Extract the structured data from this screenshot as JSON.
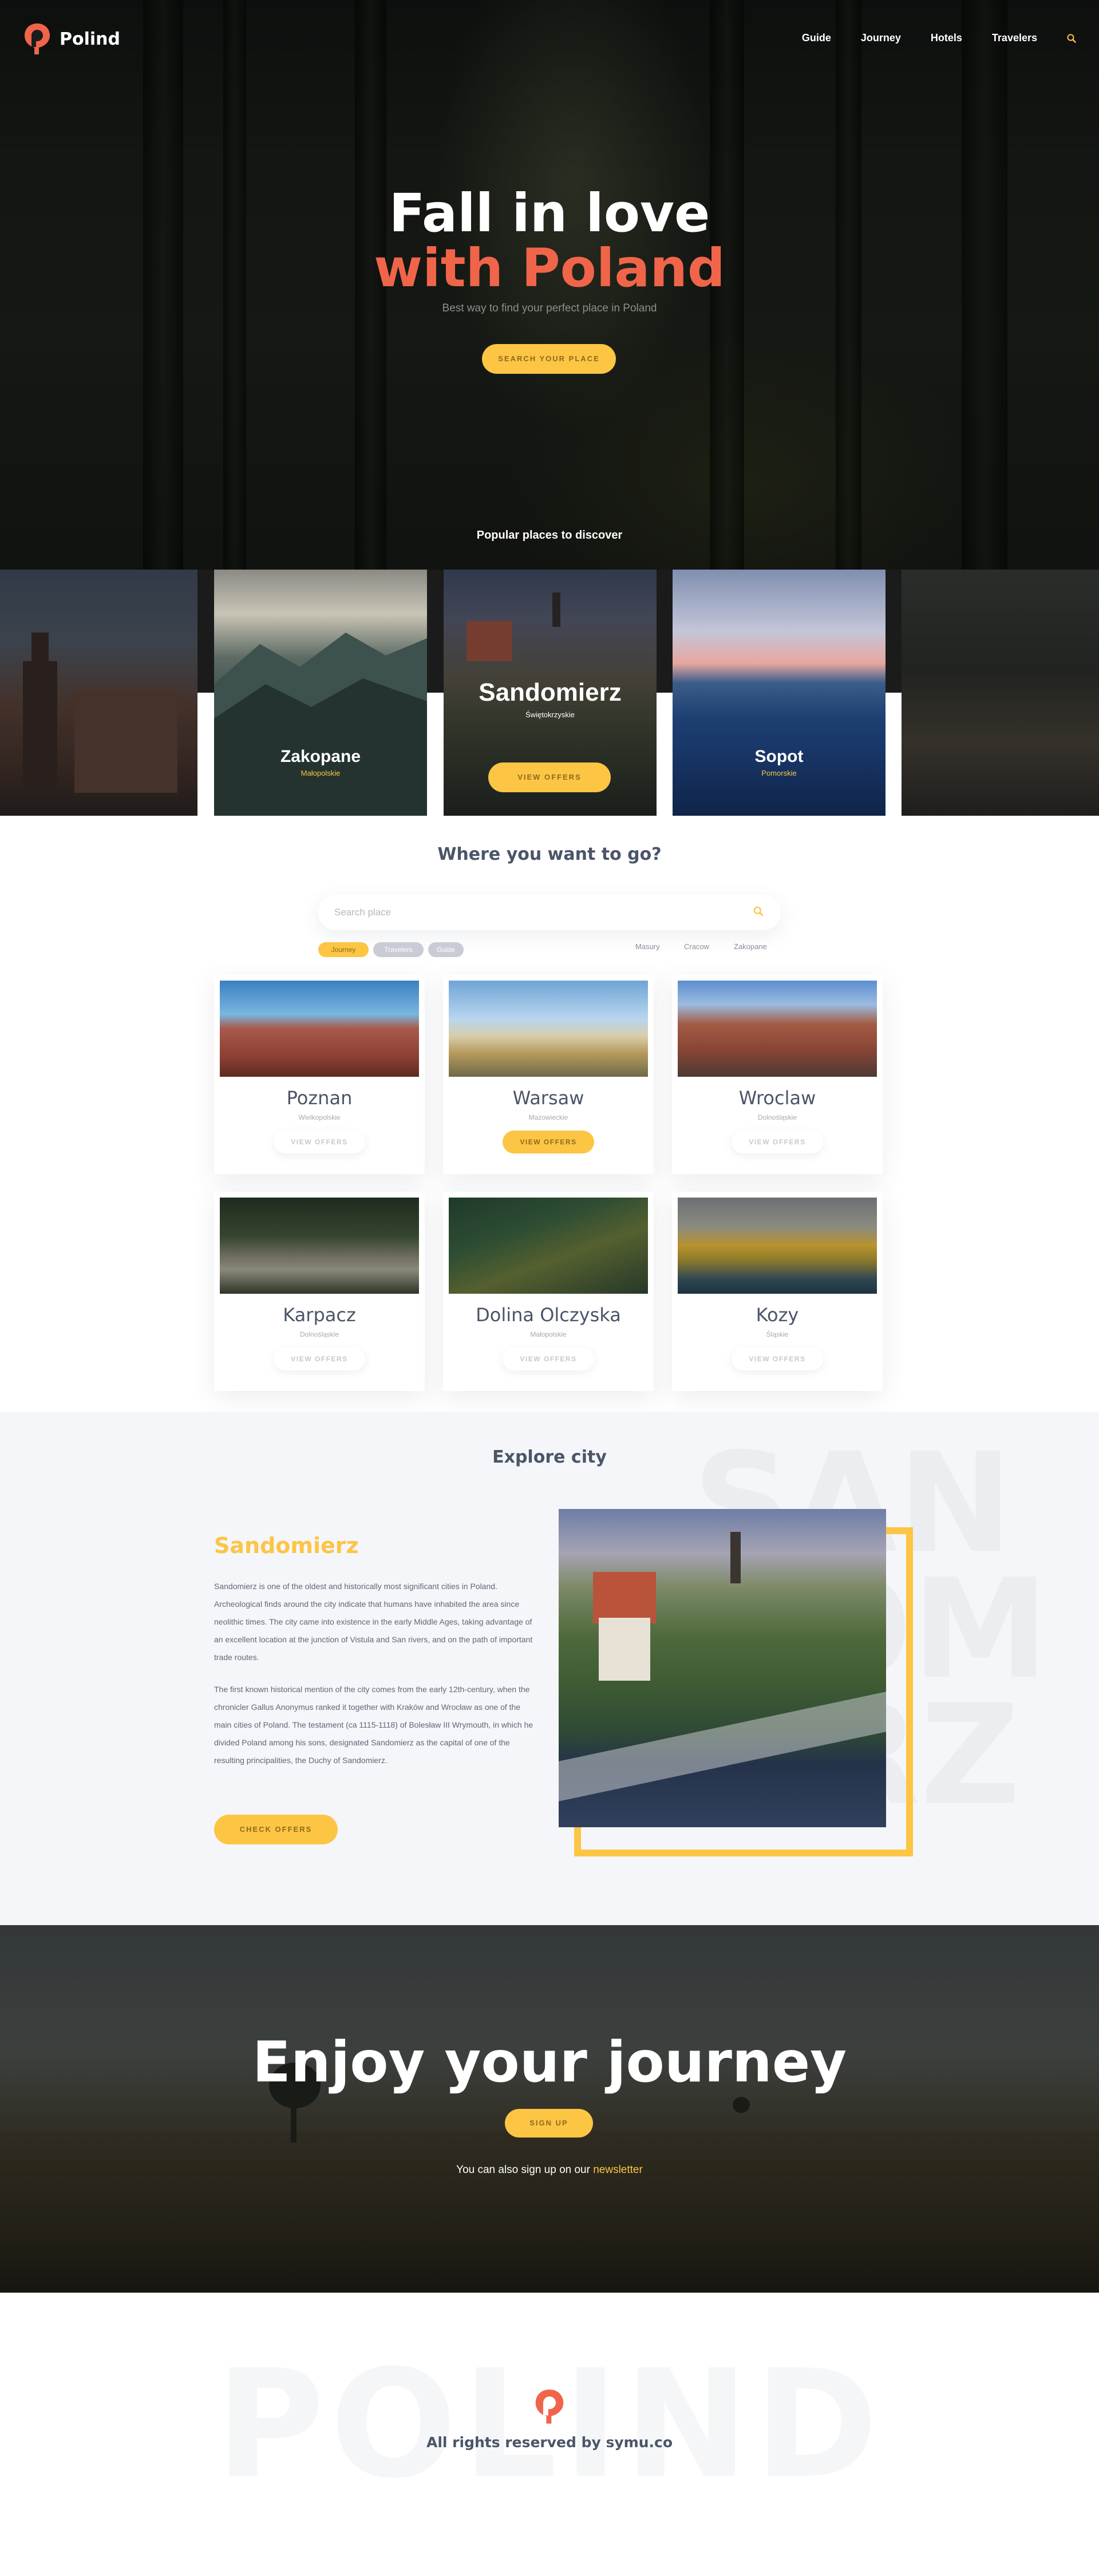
{
  "brand": {
    "name": "Polind",
    "accent": "#f0654a",
    "yellow": "#fdc544"
  },
  "nav": {
    "items": [
      "Guide",
      "Journey",
      "Hotels",
      "Travelers"
    ]
  },
  "hero": {
    "title_line1": "Fall in love",
    "title_line2": "with Poland",
    "subtitle": "Best way to find your perfect place in Poland",
    "button": "SEARCH YOUR PLACE",
    "popular_label": "Popular places to discover"
  },
  "popular_places": [
    {
      "name": "Zakopane",
      "region": "Małopolskie"
    },
    {
      "name": "Sandomierz",
      "region": "Świętokrzyskie",
      "button": "VIEW OFFERS"
    },
    {
      "name": "Sopot",
      "region": "Pomorskie"
    }
  ],
  "search": {
    "title": "Where you want to go?",
    "placeholder": "Search place",
    "tags": [
      "Journey",
      "Travelers",
      "Guide"
    ],
    "quick_links": [
      "Masury",
      "Cracow",
      "Zakopane"
    ]
  },
  "cities": [
    {
      "name": "Poznan",
      "region": "Wielkopolskie",
      "button": "VIEW OFFERS"
    },
    {
      "name": "Warsaw",
      "region": "Mazowieckie",
      "button": "VIEW OFFERS"
    },
    {
      "name": "Wroclaw",
      "region": "Dolnośląskie",
      "button": "VIEW OFFERS"
    },
    {
      "name": "Karpacz",
      "region": "Dolnośląskie",
      "button": "VIEW OFFERS"
    },
    {
      "name": "Dolina Olczyska",
      "region": "Małopolskie",
      "button": "VIEW OFFERS"
    },
    {
      "name": "Kozy",
      "region": "Śląskie",
      "button": "VIEW OFFERS"
    }
  ],
  "explore": {
    "title": "Explore city",
    "city": "Sandomierz",
    "bg_word_lines": [
      "SAN",
      "DOM",
      "IERZ"
    ],
    "paragraph1": "Sandomierz is one of the oldest and historically most significant cities in Poland. Archeological finds around the city indicate that humans have inhabited the area since neolithic times. The city came into existence in the early Middle Ages, taking advantage of an excellent location at the junction of Vistula and San rivers, and on the path of important trade routes.",
    "paragraph2": "The first known historical mention of the city comes from the early 12th-century, when the chronicler Gallus Anonymus ranked it together with Kraków and Wrocław as one of the main cities of Poland. The testament (ca 1115-1118) of Bolesław III Wrymouth, in which he divided Poland among his sons, designated Sandomierz as the capital of one of the resulting principalities, the Duchy of Sandomierz.",
    "button": "CHECK OFFERS"
  },
  "enjoy": {
    "title": "Enjoy your journey",
    "button": "SIGN UP",
    "newsletter_prefix": "You can also sign up on our ",
    "newsletter_link": "newsletter"
  },
  "footer": {
    "bg_word": "POLIND",
    "text": "All rights reserved by symu.co"
  }
}
